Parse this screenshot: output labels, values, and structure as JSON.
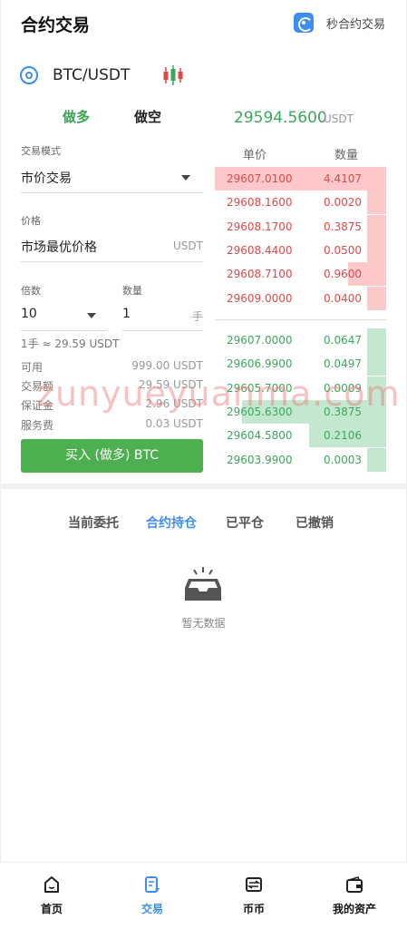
{
  "header": {
    "title": "合约交易",
    "quick_label": "秒合约交易"
  },
  "symbol": {
    "name": "BTC/USDT",
    "settings_icon": "settings-icon",
    "chart_icon": "candlestick-icon"
  },
  "side_tabs": {
    "long": "做多",
    "short": "做空"
  },
  "last_price": {
    "value": "29594.5600",
    "unit": "USDT"
  },
  "form": {
    "mode_label": "交易模式",
    "mode_value": "市价交易",
    "price_label": "价格",
    "price_value": "市场最优价格",
    "price_unit": "USDT",
    "leverage_label": "倍数",
    "leverage_value": "10",
    "qty_label": "数量",
    "qty_value": "1",
    "qty_unit": "手",
    "lot_note": "1手 ≈ 29.59 USDT",
    "info": [
      {
        "k": "可用",
        "v": "999.00 USDT"
      },
      {
        "k": "交易额",
        "v": "29.59 USDT"
      },
      {
        "k": "保证金",
        "v": "2.96 USDT"
      },
      {
        "k": "服务费",
        "v": "0.03 USDT"
      }
    ],
    "buy_button": "买入 (做多) BTC"
  },
  "orderbook": {
    "price_header": "单价",
    "qty_header": "数量",
    "asks": [
      {
        "price": "29607.0100",
        "qty": "4.4107",
        "depth": 1.0
      },
      {
        "price": "29608.1600",
        "qty": "0.0020",
        "depth": 0.11
      },
      {
        "price": "29608.1700",
        "qty": "0.3875",
        "depth": 0.11
      },
      {
        "price": "29608.4400",
        "qty": "0.0500",
        "depth": 0.11
      },
      {
        "price": "29608.7100",
        "qty": "0.9600",
        "depth": 0.22
      },
      {
        "price": "29609.0000",
        "qty": "0.0400",
        "depth": 0.11
      }
    ],
    "bids": [
      {
        "price": "29607.0000",
        "qty": "0.0647",
        "depth": 0.11
      },
      {
        "price": "29606.9900",
        "qty": "0.0497",
        "depth": 0.11
      },
      {
        "price": "29605.7000",
        "qty": "0.0009",
        "depth": 0.11
      },
      {
        "price": "29605.6300",
        "qty": "0.3875",
        "depth": 0.84
      },
      {
        "price": "29604.5800",
        "qty": "0.2106",
        "depth": 0.45
      },
      {
        "price": "29603.9900",
        "qty": "0.0003",
        "depth": 0.11
      }
    ]
  },
  "watermark": "zunyueyuanma.com",
  "position_tabs": [
    {
      "label": "当前委托",
      "active": false
    },
    {
      "label": "合约持仓",
      "active": true
    },
    {
      "label": "已平仓",
      "active": false
    },
    {
      "label": "已撤销",
      "active": false
    }
  ],
  "empty": {
    "text": "暂无数据"
  },
  "nav": [
    {
      "label": "首页",
      "icon": "home-icon",
      "active": false
    },
    {
      "label": "交易",
      "icon": "trade-icon",
      "active": true
    },
    {
      "label": "币币",
      "icon": "exchange-icon",
      "active": false
    },
    {
      "label": "我的资产",
      "icon": "wallet-icon",
      "active": false
    }
  ],
  "colors": {
    "accent": "#3d8ef0",
    "up": "#3aa85b",
    "down": "#e04848",
    "buy_button": "#4caf50"
  }
}
